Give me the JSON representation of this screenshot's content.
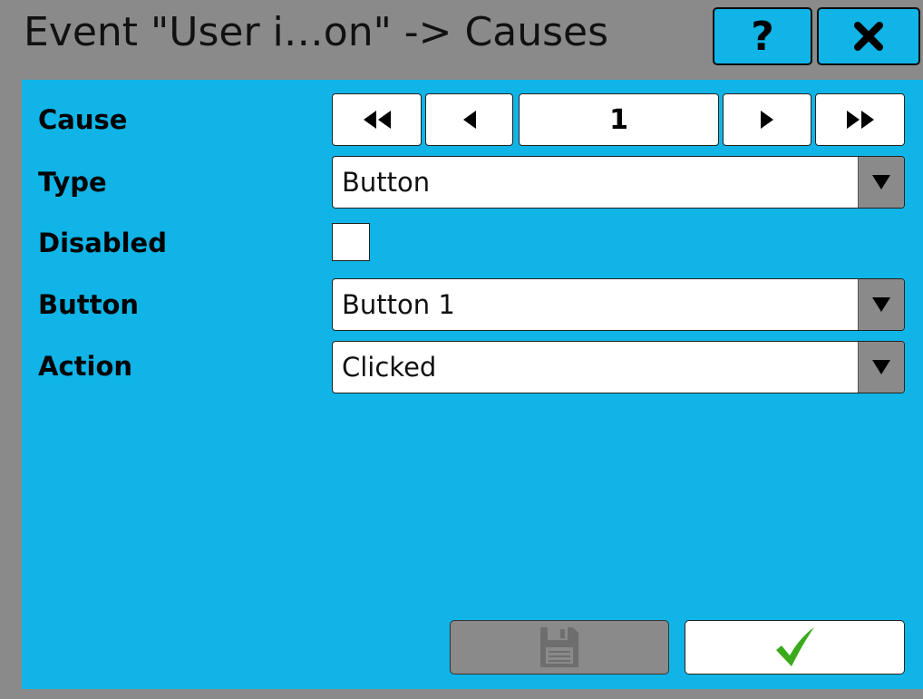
{
  "window": {
    "title": "Event \"User i…on\" -> Causes",
    "help_label": "?",
    "close_icon": "close-icon"
  },
  "colors": {
    "panel": "#10b4e6",
    "frame": "#8a8a8a",
    "ok_check": "#3aaa1c"
  },
  "form": {
    "cause": {
      "label": "Cause",
      "value": "1",
      "icons": [
        "first-icon",
        "previous-icon",
        "next-icon",
        "last-icon"
      ]
    },
    "type": {
      "label": "Type",
      "value": "Button"
    },
    "disabled": {
      "label": "Disabled",
      "checked": false
    },
    "button": {
      "label": "Button",
      "value": "Button 1"
    },
    "action": {
      "label": "Action",
      "value": "Clicked"
    }
  },
  "footer": {
    "save_icon": "save-icon",
    "save_enabled": false,
    "ok_icon": "checkmark-icon"
  }
}
